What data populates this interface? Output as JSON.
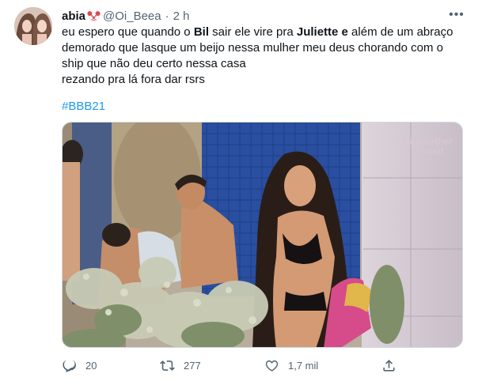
{
  "tweet": {
    "author": {
      "name": "abia",
      "handle": "@Oi_Beea",
      "separator": "·",
      "time": "2 h"
    },
    "more_label": "•••",
    "text": {
      "line1": {
        "a": "eu espero que quando o ",
        "b": "Bil",
        "c": " sair ele vire pra ",
        "d": "Juliette",
        "e": " e",
        "f": " além de um abraço"
      },
      "line2": "demorado que lasque um beijo nessa mulher meu deus chorando com o",
      "line3": "ship que não deu certo nessa casa",
      "line4": "rezando pra lá fora dar rsrs"
    },
    "hashtag": "#BBB21",
    "media": {
      "watermark_line1": "BigBrother",
      "watermark_line2": "Brasil"
    },
    "actions": {
      "reply": {
        "icon": "reply-icon",
        "count": "20"
      },
      "retweet": {
        "icon": "retweet-icon",
        "count": "277"
      },
      "like": {
        "icon": "heart-icon",
        "count": "1,7 mil"
      },
      "share": {
        "icon": "share-icon"
      }
    },
    "colors": {
      "text": "#0f1419",
      "secondary": "#536471",
      "link": "#1d9bf0",
      "border": "#cfd9de"
    }
  }
}
